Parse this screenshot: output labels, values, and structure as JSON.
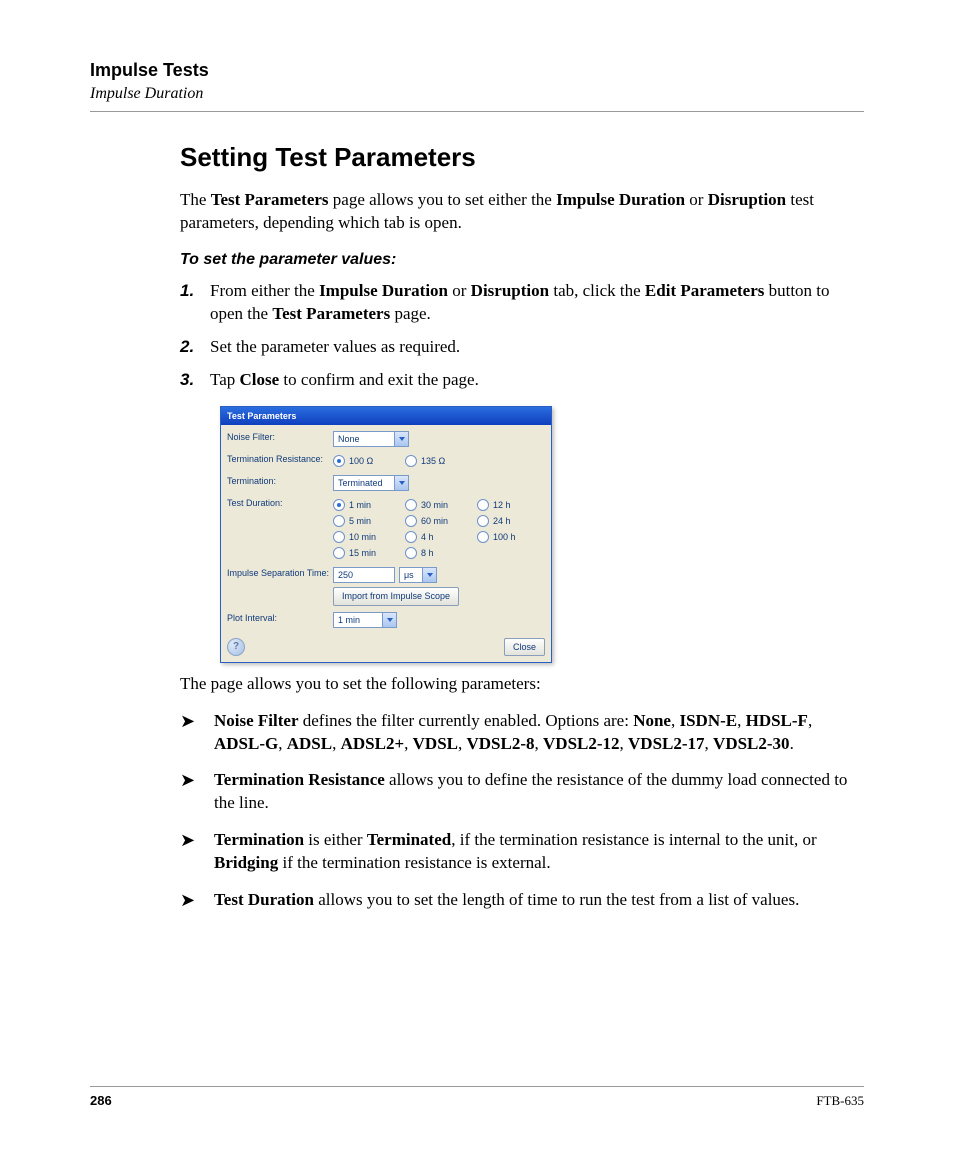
{
  "header": {
    "title": "Impulse Tests",
    "subtitle": "Impulse Duration"
  },
  "section_title": "Setting Test Parameters",
  "intro": {
    "p1_a": "The ",
    "p1_b": "Test Parameters",
    "p1_c": " page allows you to set either the ",
    "p1_d": "Impulse Duration",
    "p1_e": " or ",
    "p1_f": "Disruption",
    "p1_g": " test parameters, depending which tab is open."
  },
  "subheading": "To set the parameter values:",
  "steps": [
    {
      "num": "1.",
      "a": "From either the ",
      "b": "Impulse Duration",
      "c": " or ",
      "d": "Disruption",
      "e": " tab, click the ",
      "f": "Edit Parameters",
      "g": " button to open the ",
      "h": "Test Parameters",
      "i": " page."
    },
    {
      "num": "2.",
      "a": "Set the parameter values as required."
    },
    {
      "num": "3.",
      "a": "Tap ",
      "b": "Close",
      "c": " to confirm and exit the page."
    }
  ],
  "dialog": {
    "title": "Test Parameters",
    "labels": {
      "noise_filter": "Noise Filter:",
      "term_res": "Termination Resistance:",
      "termination": "Termination:",
      "test_duration": "Test Duration:",
      "sep_time": "Impulse Separation Time:",
      "plot_interval": "Plot Interval:"
    },
    "noise_filter_value": "None",
    "term_res_options": [
      "100 Ω",
      "135 Ω"
    ],
    "term_res_selected": 0,
    "termination_value": "Terminated",
    "duration_options": [
      "1 min",
      "5 min",
      "10 min",
      "15 min",
      "30 min",
      "60 min",
      "4 h",
      "8 h",
      "12 h",
      "24 h",
      "100 h"
    ],
    "duration_selected": 0,
    "sep_time_value": "250",
    "sep_time_unit": "μs",
    "import_label": "Import from Impulse Scope",
    "plot_interval_value": "1 min",
    "help_glyph": "?",
    "close_label": "Close"
  },
  "below_dialog": "The page allows you to set the following parameters:",
  "bullets": [
    {
      "a": "Noise Filter",
      "b": " defines the filter currently enabled. Options are: ",
      "c": "None",
      "list": [
        "ISDN-E",
        "HDSL-F",
        "ADSL-G",
        "ADSL",
        "ADSL2+",
        "VDSL",
        "VDSL2-8",
        "VDSL2-12",
        "VDSL2-17",
        "VDSL2-30"
      ],
      "sep": ", ",
      "period": "."
    },
    {
      "a": "Termination Resistance",
      "b": " allows you to define the resistance of the dummy load connected to the line."
    },
    {
      "a": "Termination",
      "b": " is either ",
      "c": "Terminated",
      "d": ", if the termination resistance is internal to the unit, or ",
      "e": "Bridging",
      "f": " if the termination resistance is external."
    },
    {
      "a": "Test Duration",
      "b": " allows you to set the length of time to run the test from a list of values."
    }
  ],
  "footer": {
    "page": "286",
    "doc": "FTB-635"
  }
}
